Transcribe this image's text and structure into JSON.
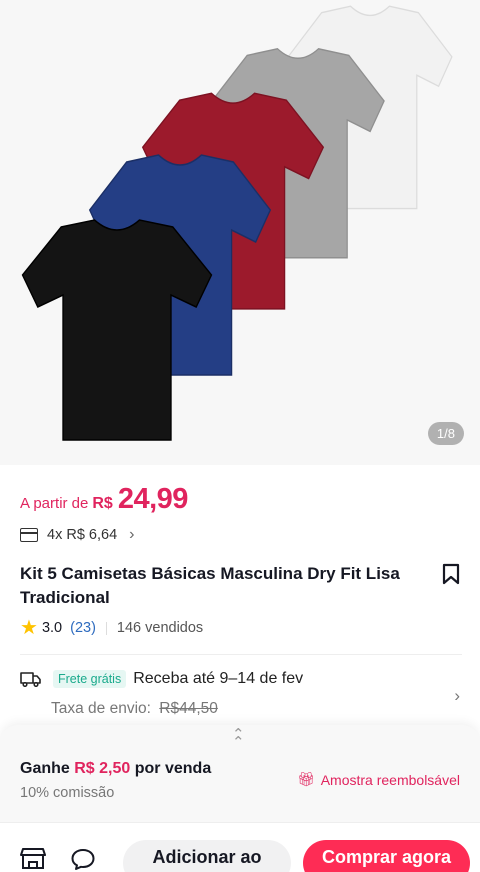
{
  "gallery": {
    "page_indicator": "1/8",
    "shirt_colors": [
      "#f2f2f2",
      "#a6a6a6",
      "#9c1a2c",
      "#243e85",
      "#141414"
    ]
  },
  "price": {
    "prefix": "A partir de",
    "currency": "R$",
    "value": "24,99",
    "color": "#e0245e"
  },
  "installment": {
    "text": "4x R$ 6,64"
  },
  "product": {
    "title": "Kit 5 Camisetas Básicas Masculina Dry Fit Lisa Tradicional"
  },
  "rating": {
    "score": "3.0",
    "count": "(23)",
    "sold": "146 vendidos"
  },
  "shipping": {
    "badge": "Frete grátis",
    "delivery": "Receba até 9–14 de fev",
    "fee_label": "Taxa de envio:",
    "fee_old": "R$44,50"
  },
  "affiliate": {
    "earn_prefix": "Ganhe",
    "earn_amount": "R$ 2,50",
    "earn_suffix": "por venda",
    "commission": "10% comissão",
    "sample": "Amostra reembolsável"
  },
  "actions": {
    "add_to_cart": "Adicionar ao",
    "buy_now": "Comprar agora"
  },
  "colors": {
    "accent": "#fe2c55",
    "link": "#2f6cbf",
    "free_shipping": "#1aaa8c"
  }
}
